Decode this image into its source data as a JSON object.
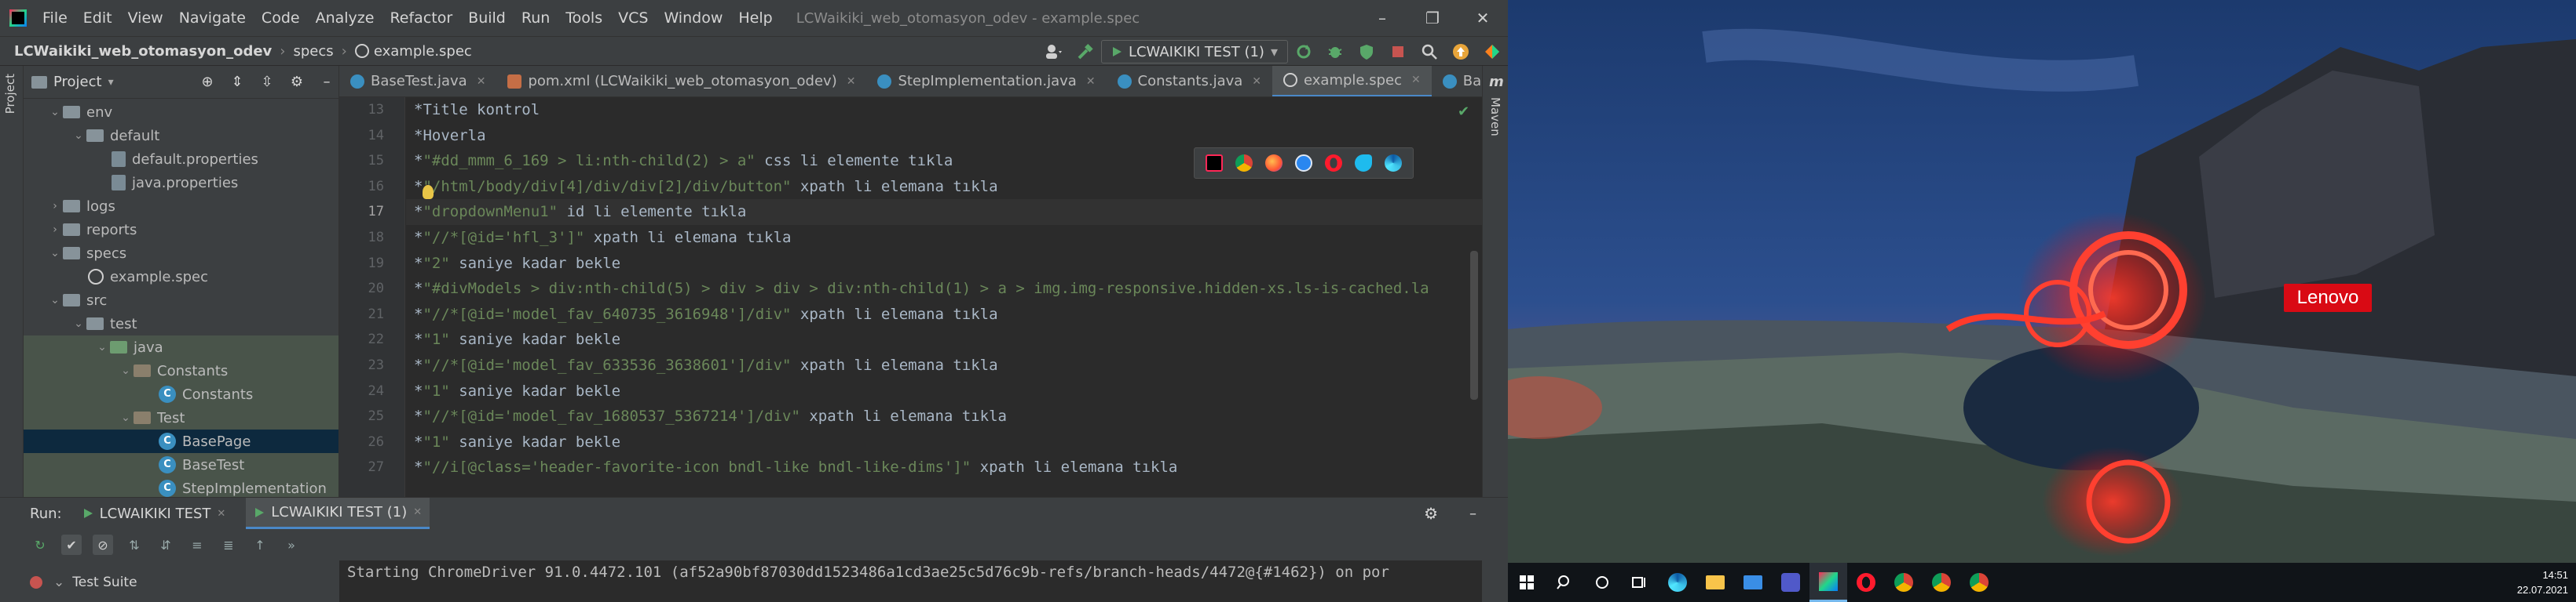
{
  "app": {
    "menu": [
      "File",
      "Edit",
      "View",
      "Navigate",
      "Code",
      "Analyze",
      "Refactor",
      "Build",
      "Run",
      "Tools",
      "VCS",
      "Window",
      "Help"
    ],
    "window_title": "LCWaikiki_web_otomasyon_odev - example.spec",
    "window_buttons": [
      "–",
      "❐",
      "✕"
    ]
  },
  "navbar": {
    "breadcrumb": [
      "LCWaikiki_web_otomasyon_odev",
      "specs",
      "example.spec"
    ],
    "run_config": "LCWAIKIKI TEST (1)"
  },
  "sidebar_strip": {
    "project_label": "Project"
  },
  "right_strip": {
    "maven_label": "Maven"
  },
  "project_panel": {
    "title": "Project",
    "items": [
      {
        "label": "env"
      },
      {
        "label": "default"
      },
      {
        "label": "default.properties"
      },
      {
        "label": "java.properties"
      },
      {
        "label": "logs"
      },
      {
        "label": "reports"
      },
      {
        "label": "specs"
      },
      {
        "label": "example.spec"
      },
      {
        "label": "src"
      },
      {
        "label": "test"
      },
      {
        "label": "java"
      },
      {
        "label": "Constants"
      },
      {
        "label": "Constants"
      },
      {
        "label": "Test"
      },
      {
        "label": "BasePage"
      },
      {
        "label": "BaseTest"
      },
      {
        "label": "StepImplementation"
      }
    ]
  },
  "editor": {
    "tabs": [
      {
        "label": "BaseTest.java"
      },
      {
        "label": "pom.xml (LCWaikiki_web_otomasyon_odev)"
      },
      {
        "label": "StepImplementation.java"
      },
      {
        "label": "Constants.java"
      },
      {
        "label": "example.spec"
      },
      {
        "label": "BasePage.java"
      }
    ],
    "line_numbers": [
      "13",
      "14",
      "15",
      "16",
      "17",
      "18",
      "19",
      "20",
      "21",
      "22",
      "23",
      "24",
      "25",
      "26",
      "27"
    ],
    "lines": [
      "*Title kontrol",
      "*Hoverla",
      "*\"#dd_mmm_6_169 > li:nth-child(2) > a\" css li elemente tıkla",
      "*\"/html/body/div[4]/div/div[2]/div/button\" xpath li elemana tıkla",
      "*\"dropdownMenu1\" id li elemente tıkla",
      "*\"//*[@id='hfl_3']\" xpath li elemana tıkla",
      "*\"2\" saniye kadar bekle",
      "*\"#divModels > div:nth-child(5) > div > div > div:nth-child(1) > a > img.img-responsive.hidden-xs.ls-is-cached.la",
      "*\"//*[@id='model_fav_640735_3616948']/div\" xpath li elemana tıkla",
      "*\"1\" saniye kadar bekle",
      "*\"//*[@id='model_fav_633536_3638601']/div\" xpath li elemana tıkla",
      "*\"1\" saniye kadar bekle",
      "*\"//*[@id='model_fav_1680537_5367214']/div\" xpath li elemana tıkla",
      "*\"1\" saniye kadar bekle",
      "*\"//i[@class='header-favorite-icon bndl-like bndl-like-dims']\" xpath li elemana tıkla"
    ]
  },
  "run_panel": {
    "run_label": "Run:",
    "tabs": [
      {
        "label": "LCWAIKIKI TEST"
      },
      {
        "label": "LCWAIKIKI TEST (1)"
      }
    ],
    "suite_label": "Test Suite",
    "console_line": "Starting ChromeDriver 91.0.4472.101 (af52a90bf87030dd1523486a1cd3ae25c5d76c9b-refs/branch-heads/4472@{#1462}) on por"
  },
  "desktop": {
    "brand": "Lenovo",
    "clock_time": "14:51",
    "clock_date": "22.07.2021"
  },
  "colors": {
    "ide_bg": "#2b2b2b",
    "panel_bg": "#3c3f41",
    "string": "#6a8759",
    "accent": "#4a88c7",
    "lenovo_red": "#d90a14"
  }
}
